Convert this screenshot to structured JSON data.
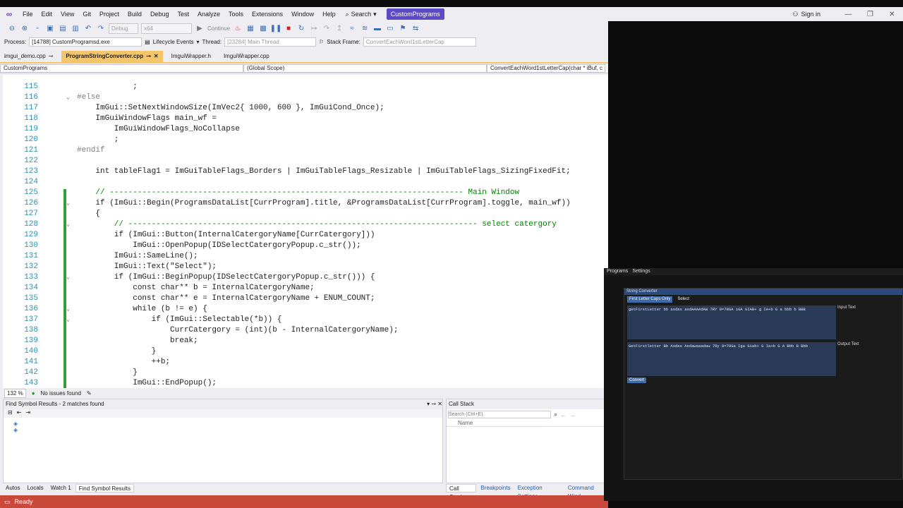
{
  "menubar": {
    "items": [
      "File",
      "Edit",
      "View",
      "Git",
      "Project",
      "Build",
      "Debug",
      "Test",
      "Analyze",
      "Tools",
      "Extensions",
      "Window",
      "Help"
    ],
    "search_label": "Search",
    "project_name": "CustomPrograms",
    "signin_label": "Sign in"
  },
  "toolbar1": {
    "config": "Debug",
    "platform": "x64",
    "continue_label": "Continue"
  },
  "toolbar2": {
    "process_label": "Process:",
    "process_value": "[14788] CustomProgramsd.exe",
    "lifecycle_label": "Lifecycle Events",
    "thread_label": "Thread:",
    "thread_value": "[23284] Main Thread",
    "stackframe_label": "Stack Frame:",
    "stackframe_value": "ConvertEachWord1stLetterCap"
  },
  "tabs": [
    {
      "label": "imgui_demo.cpp",
      "active": false
    },
    {
      "label": "ProgramStringConverter.cpp",
      "active": true
    },
    {
      "label": "ImguiWrapper.h",
      "active": false
    },
    {
      "label": "ImguiWrapper.cpp",
      "active": false
    }
  ],
  "navbar": {
    "project": "CustomPrograms",
    "scope": "(Global Scope)",
    "function": "ConvertEachWord1stLetterCap(char * iBuf, c"
  },
  "code": [
    {
      "ln": "115",
      "text": "            ;"
    },
    {
      "ln": "116",
      "text": "#else"
    },
    {
      "ln": "117",
      "text": "    ImGui::SetNextWindowSize(ImVec2{ 1000, 600 }, ImGuiCond_Once);"
    },
    {
      "ln": "118",
      "text": "    ImGuiWindowFlags main_wf ="
    },
    {
      "ln": "119",
      "text": "        ImGuiWindowFlags_NoCollapse"
    },
    {
      "ln": "120",
      "text": "        ;"
    },
    {
      "ln": "121",
      "text": "#endif"
    },
    {
      "ln": "122",
      "text": ""
    },
    {
      "ln": "123",
      "text": "    int tableFlag1 = ImGuiTableFlags_Borders | ImGuiTableFlags_Resizable | ImGuiTableFlags_SizingFixedFit;"
    },
    {
      "ln": "124",
      "text": ""
    },
    {
      "ln": "125",
      "text": "    // ---------------------------------------------------------------------------- Main Window"
    },
    {
      "ln": "126",
      "text": "    if (ImGui::Begin(ProgramsDataList[CurrProgram].title, &ProgramsDataList[CurrProgram].toggle, main_wf))"
    },
    {
      "ln": "127",
      "text": "    {"
    },
    {
      "ln": "128",
      "text": "        // --------------------------------------------------------------------------- select catergory"
    },
    {
      "ln": "129",
      "text": "        if (ImGui::Button(InternalCatergoryName[CurrCatergory]))"
    },
    {
      "ln": "130",
      "text": "            ImGui::OpenPopup(IDSelectCatergoryPopup.c_str());"
    },
    {
      "ln": "131",
      "text": "        ImGui::SameLine();"
    },
    {
      "ln": "132",
      "text": "        ImGui::Text(\"Select\");"
    },
    {
      "ln": "133",
      "text": "        if (ImGui::BeginPopup(IDSelectCatergoryPopup.c_str())) {"
    },
    {
      "ln": "134",
      "text": "            const char** b = InternalCatergoryName;"
    },
    {
      "ln": "135",
      "text": "            const char** e = InternalCatergoryName + ENUM_COUNT;"
    },
    {
      "ln": "136",
      "text": "            while (b != e) {"
    },
    {
      "ln": "137",
      "text": "                if (ImGui::Selectable(*b)) {"
    },
    {
      "ln": "138",
      "text": "                    CurrCatergory = (int)(b - InternalCatergoryName);"
    },
    {
      "ln": "139",
      "text": "                    break;"
    },
    {
      "ln": "140",
      "text": "                }"
    },
    {
      "ln": "141",
      "text": "                ++b;"
    },
    {
      "ln": "142",
      "text": "            }"
    },
    {
      "ln": "143",
      "text": "            ImGui::EndPopup();"
    }
  ],
  "editor_status": {
    "zoom": "132 %",
    "issues": "No issues found"
  },
  "find_panel": {
    "title": "Find Symbol Results - 2 matches found"
  },
  "callstack_panel": {
    "title": "Call Stack",
    "search_placeholder": "Search (Ctrl+E)",
    "column_name": "Name"
  },
  "bottom_tabs_left": [
    "Autos",
    "Locals",
    "Watch 1",
    "Find Symbol Results"
  ],
  "bottom_tabs_right": [
    "Call Stack",
    "Breakpoints",
    "Exception Settings",
    "Command Wind"
  ],
  "statusbar": {
    "text": "Ready"
  },
  "imgui": {
    "menu": [
      "Programs",
      "Settings"
    ],
    "window_title": "String Converter",
    "tab_active": "First Letter Caps Only",
    "tab_select": "Select",
    "input_text": "getFirstLetter bb asdas asdAAAAdAW 7RY 8=78GA iGA GIAB+ g IA+b G a bbb b BBB",
    "input_label": "Input Text",
    "output_text": "GetFirstletter Bb Asdas Asdawaaadaw 7Ry 8=78Ga Iga Giab+ G Ia+b G A Bbb B Bbb",
    "output_label": "Output Text",
    "convert_label": "Convert"
  }
}
